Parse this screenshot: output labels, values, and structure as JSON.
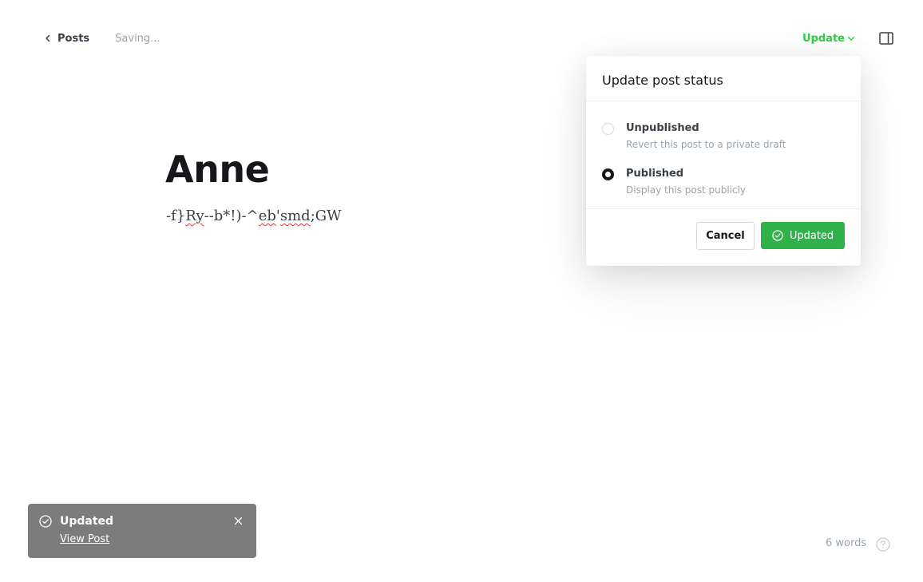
{
  "header": {
    "back_label": "Posts",
    "save_status": "Saving...",
    "update_label": "Update",
    "accent_color": "#30cf43"
  },
  "editor": {
    "title": "Anne",
    "body_segments": [
      "-f}",
      "Ry",
      "--b*!)-^",
      "eb",
      "'",
      "smd",
      ";GW"
    ]
  },
  "popover": {
    "title": "Update post status",
    "options": [
      {
        "label": "Unpublished",
        "description": "Revert this post to a private draft",
        "selected": false
      },
      {
        "label": "Published",
        "description": "Display this post publicly",
        "selected": true
      }
    ],
    "cancel_label": "Cancel",
    "confirm_label": "Updated",
    "confirm_color": "#30b14a"
  },
  "toast": {
    "title": "Updated",
    "link_label": "View Post",
    "background": "#7c7c7c"
  },
  "footer": {
    "word_count": "6 words",
    "help_icon": "question-circle-icon"
  }
}
